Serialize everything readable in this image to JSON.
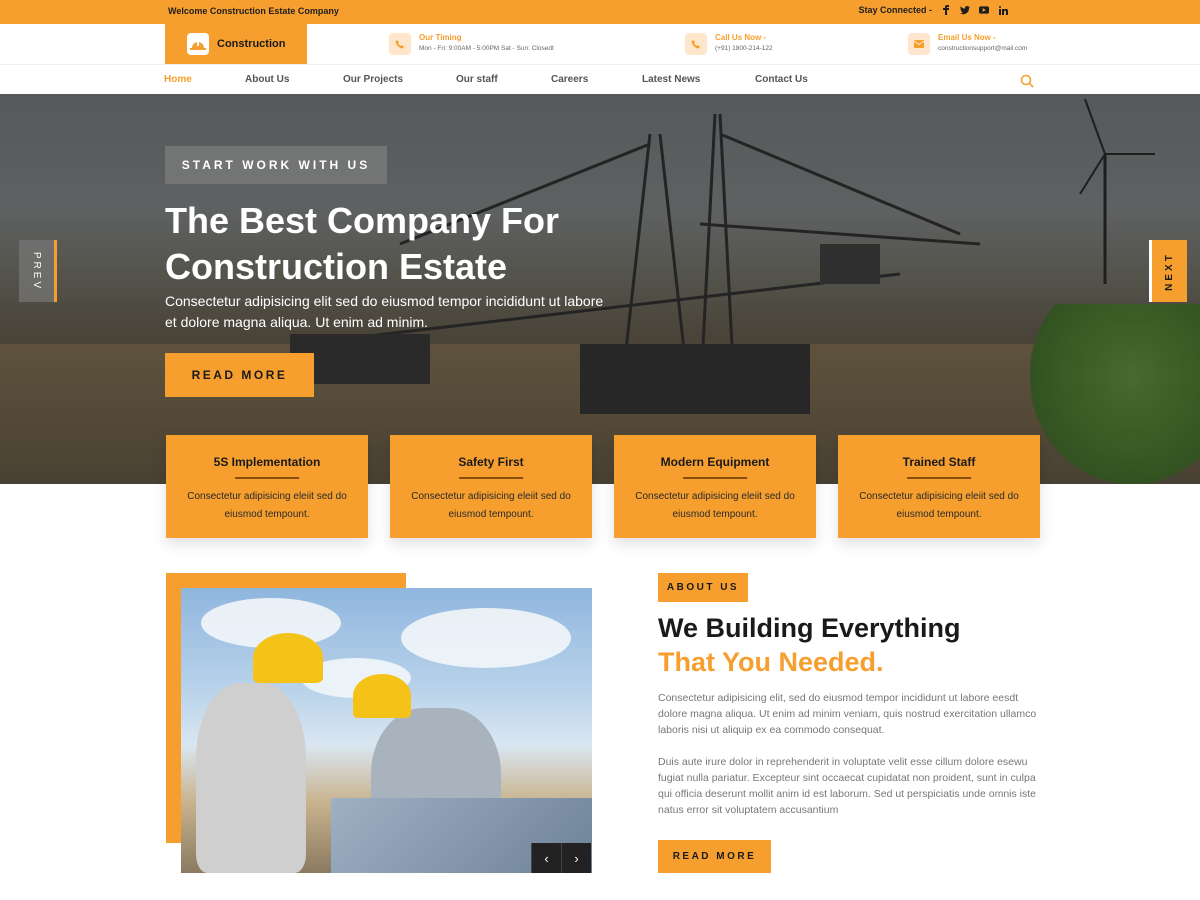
{
  "topbar": {
    "welcome": "Welcome Construction Estate Company",
    "stay_connected": "Stay Connected -",
    "social_icons": [
      "facebook-icon",
      "twitter-icon",
      "youtube-icon",
      "linkedin-icon"
    ]
  },
  "header": {
    "logo_text": "Construction",
    "timing": {
      "title": "Our Timing",
      "detail": "Mon - Fri: 9:00AM - 5:00PM  Sat - Sun: Closedt"
    },
    "call": {
      "title": "Call Us Now -",
      "detail": "(+91) 1800-214-122"
    },
    "email": {
      "title": "Email Us Now -",
      "detail": "constructionsupport@mail.com"
    }
  },
  "nav": {
    "items": [
      "Home",
      "About Us",
      "Our Projects",
      "Our staff",
      "Careers",
      "Latest News",
      "Contact Us"
    ],
    "active": "Home"
  },
  "hero": {
    "tag": "START WORK WITH US",
    "title_line1": "The Best Company For",
    "title_line2": "Construction Estate",
    "subtitle": "Consectetur adipisicing elit sed do eiusmod tempor incididunt ut labore et dolore magna aliqua. Ut enim ad minim.",
    "button": "READ MORE",
    "prev": "PREV",
    "next": "NEXT"
  },
  "features": [
    {
      "title": "5S Implementation",
      "text": "Consectetur adipisicing eleiit sed do eiusmod tempount."
    },
    {
      "title": "Safety First",
      "text": "Consectetur adipisicing eleiit sed do eiusmod tempount."
    },
    {
      "title": "Modern Equipment",
      "text": "Consectetur adipisicing eleiit sed do eiusmod tempount."
    },
    {
      "title": "Trained Staff",
      "text": "Consectetur adipisicing eleiit sed do eiusmod tempount."
    }
  ],
  "about": {
    "tag": "ABOUT US",
    "heading1": "We Building Everything",
    "heading2": "That You Needed.",
    "para1": "Consectetur adipisicing elit, sed do eiusmod tempor incididunt ut labore eesdt dolore magna aliqua. Ut enim ad minim veniam, quis nostrud exercitation ullamco laboris nisi ut aliquip ex ea commodo consequat.",
    "para2": "Duis aute irure dolor in reprehenderit in voluptate velit esse cillum dolore esewu fugiat nulla pariatur. Excepteur sint occaecat cupidatat non proident, sunt in culpa qui officia deserunt mollit anim id est laborum. Sed ut perspiciatis unde omnis iste natus error sit voluptatem accusantium",
    "button": "READ MORE",
    "prev_arrow": "‹",
    "next_arrow": "›"
  },
  "colors": {
    "accent": "#f79f2e",
    "dark": "#1a1a1a",
    "muted": "#777777"
  }
}
